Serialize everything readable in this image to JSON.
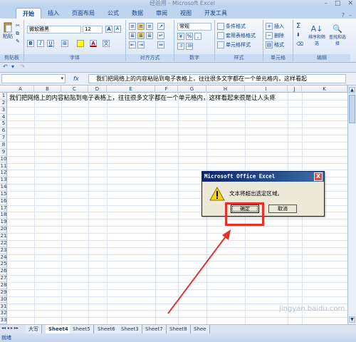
{
  "window": {
    "title": "经验用 - Microsoft Excel",
    "controls": [
      "–",
      "□",
      "✕"
    ]
  },
  "tabs": [
    "开始",
    "插入",
    "页面布局",
    "公式",
    "数据",
    "审阅",
    "视图",
    "开发工具"
  ],
  "ribbon": {
    "clipboard": {
      "paste": "粘贴",
      "label": "剪贴板"
    },
    "font": {
      "name": "微软雅黑",
      "size": "12",
      "bold": "B",
      "italic": "I",
      "underline": "U",
      "grow": "A",
      "shrink": "A",
      "fontcolor": "A",
      "label": "字体"
    },
    "alignment": {
      "label": "对齐方式"
    },
    "number": {
      "format": "常规",
      "label": "数字"
    },
    "styles": {
      "conditional": "条件格式",
      "table": "套用表格格式",
      "cell": "单元格样式",
      "label": "样式"
    },
    "cells": {
      "insert": "插入",
      "delete": "删除",
      "format": "格式",
      "label": "单元格"
    },
    "editing": {
      "sum": "Σ",
      "sort": "排序和筛选",
      "find": "查找和选择",
      "label": "编辑"
    }
  },
  "formula_bar": {
    "fx": "fx",
    "content": "我们把网络上的内容粘贴到电子表格上，往往很多文字都在一个单元格内，这样看起"
  },
  "columns": [
    "A",
    "B",
    "C",
    "D",
    "E",
    "F",
    "G",
    "H",
    "I",
    "J",
    "K"
  ],
  "rows": [
    "1",
    "2",
    "3",
    "4",
    "5",
    "6",
    "7",
    "8",
    "9",
    "10",
    "11",
    "12",
    "13",
    "14",
    "15",
    "16",
    "17",
    "18",
    "19",
    "20",
    "21",
    "22",
    "23",
    "24",
    "25",
    "26",
    "27",
    "28",
    "29",
    "30",
    "31",
    "32",
    "33"
  ],
  "cell_a1": "我们把网络上的内容粘贴到电子表格上，往往很多文字都在一个单元格内，这样看起来很是让人头疼",
  "sheets": [
    "大写",
    "Sheet4",
    "Sheet5",
    "Sheet6",
    "Sheet3",
    "Sheet7",
    "Sheet8",
    "Shee"
  ],
  "sheet_nav": "◂◂ ◂ ▸ ▸▸",
  "status": "就绪",
  "dialog": {
    "title": "Microsoft Office Excel",
    "close": "X",
    "message": "文本将超出选定区域。",
    "ok": "确定",
    "cancel": "取消"
  },
  "watermark": "jingyan.baidu.com",
  "colors": {
    "highlight": "#e8302a",
    "dialog_title": "#0a246a",
    "ribbon": "#dbe7f6"
  }
}
